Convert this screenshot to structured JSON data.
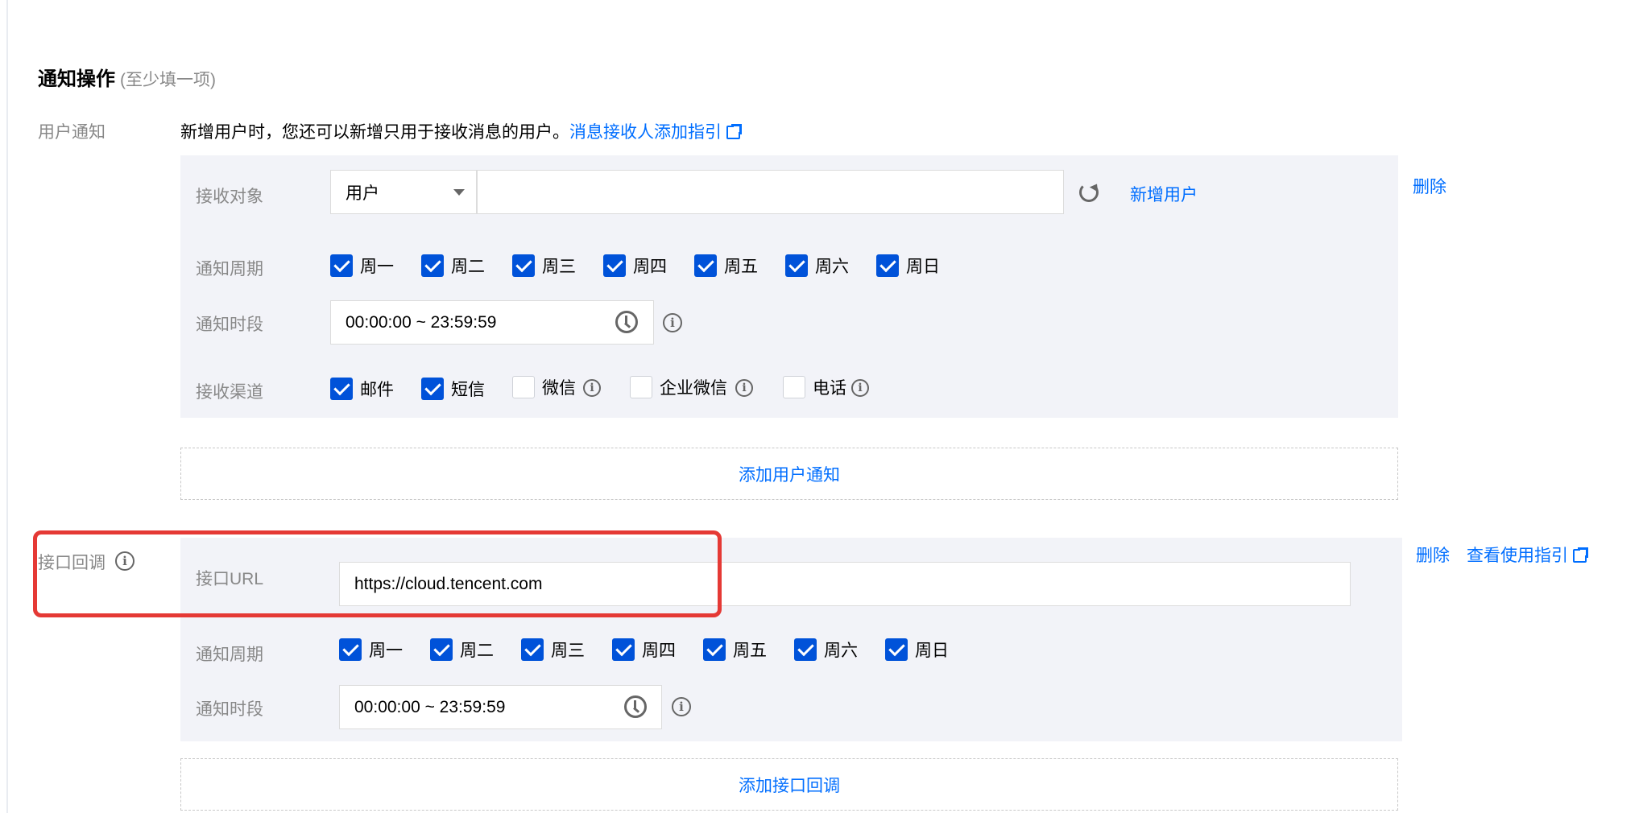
{
  "section": {
    "title": "通知操作",
    "hint": "(至少填一项)"
  },
  "user_notify": {
    "label": "用户通知",
    "description": "新增用户时，您还可以新增只用于接收消息的用户。",
    "guide_link": "消息接收人添加指引",
    "delete_label": "删除",
    "receiver": {
      "label": "接收对象",
      "select_value": "用户",
      "input_value": "",
      "add_user_label": "新增用户"
    },
    "cycle": {
      "label": "通知周期",
      "days": [
        {
          "label": "周一",
          "checked": true
        },
        {
          "label": "周二",
          "checked": true
        },
        {
          "label": "周三",
          "checked": true
        },
        {
          "label": "周四",
          "checked": true
        },
        {
          "label": "周五",
          "checked": true
        },
        {
          "label": "周六",
          "checked": true
        },
        {
          "label": "周日",
          "checked": true
        }
      ]
    },
    "time_range": {
      "label": "通知时段",
      "value": "00:00:00 ~ 23:59:59"
    },
    "channels": {
      "label": "接收渠道",
      "items": [
        {
          "label": "邮件",
          "checked": true
        },
        {
          "label": "短信",
          "checked": true
        },
        {
          "label": "微信",
          "checked": false
        },
        {
          "label": "企业微信",
          "checked": false
        },
        {
          "label": "电话",
          "checked": false
        }
      ]
    },
    "add_button": "添加用户通知"
  },
  "callback": {
    "label": "接口回调",
    "delete_label": "删除",
    "guide_link": "查看使用指引",
    "url": {
      "label": "接口URL",
      "value": "https://cloud.tencent.com"
    },
    "cycle": {
      "label": "通知周期",
      "days": [
        {
          "label": "周一",
          "checked": true
        },
        {
          "label": "周二",
          "checked": true
        },
        {
          "label": "周三",
          "checked": true
        },
        {
          "label": "周四",
          "checked": true
        },
        {
          "label": "周五",
          "checked": true
        },
        {
          "label": "周六",
          "checked": true
        },
        {
          "label": "周日",
          "checked": true
        }
      ]
    },
    "time_range": {
      "label": "通知时段",
      "value": "00:00:00 ~ 23:59:59"
    },
    "add_button": "添加接口回调"
  },
  "colors": {
    "link": "#006eff",
    "checkbox": "#0052d9",
    "panel_bg": "#f2f3f8",
    "highlight_border": "#e53935"
  },
  "icons": [
    "external-link-icon",
    "refresh-icon",
    "clock-icon",
    "info-icon",
    "chevron-down-icon"
  ]
}
